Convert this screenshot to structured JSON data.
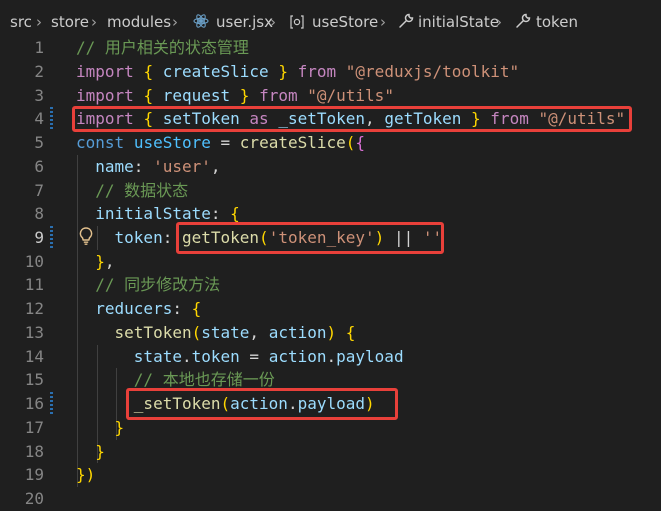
{
  "breadcrumb": {
    "items": [
      "src",
      "store",
      "modules",
      "user.jsx",
      "useStore",
      "initialState",
      "token"
    ],
    "separator": "›"
  },
  "line_numbers": [
    "1",
    "2",
    "3",
    "4",
    "5",
    "6",
    "7",
    "8",
    "9",
    "10",
    "11",
    "12",
    "13",
    "14",
    "15",
    "16",
    "17",
    "18",
    "19",
    "20"
  ],
  "active_line": "9",
  "code_lines": [
    "// 用户相关的状态管理",
    "import { createSlice } from \"@reduxjs/toolkit\"",
    "import { request } from \"@/utils\"",
    "import { setToken as _setToken, getToken } from \"@/utils\"",
    "const useStore = createSlice({",
    "  name: 'user',",
    "  // 数据状态",
    "  initialState: {",
    "    token: getToken('token_key') || ''",
    "  },",
    "  // 同步修改方法",
    "  reducers: {",
    "    setToken(state, action) {",
    "      state.token = action.payload",
    "      // 本地也存储一份",
    "      _setToken(action.payload)",
    "    }",
    "  }",
    "})",
    ""
  ],
  "colors": {
    "background": "#1f1f1f",
    "highlight_box": "#e8403a",
    "keyword": "#569cd6",
    "import_keyword": "#c586c0",
    "function": "#dcdcaa",
    "variable": "#9cdcfe",
    "string": "#ce9178",
    "comment": "#6a9955"
  },
  "icons": [
    "js-file-icon",
    "symbol-variable-icon",
    "wrench-icon",
    "lightbulb-icon"
  ]
}
